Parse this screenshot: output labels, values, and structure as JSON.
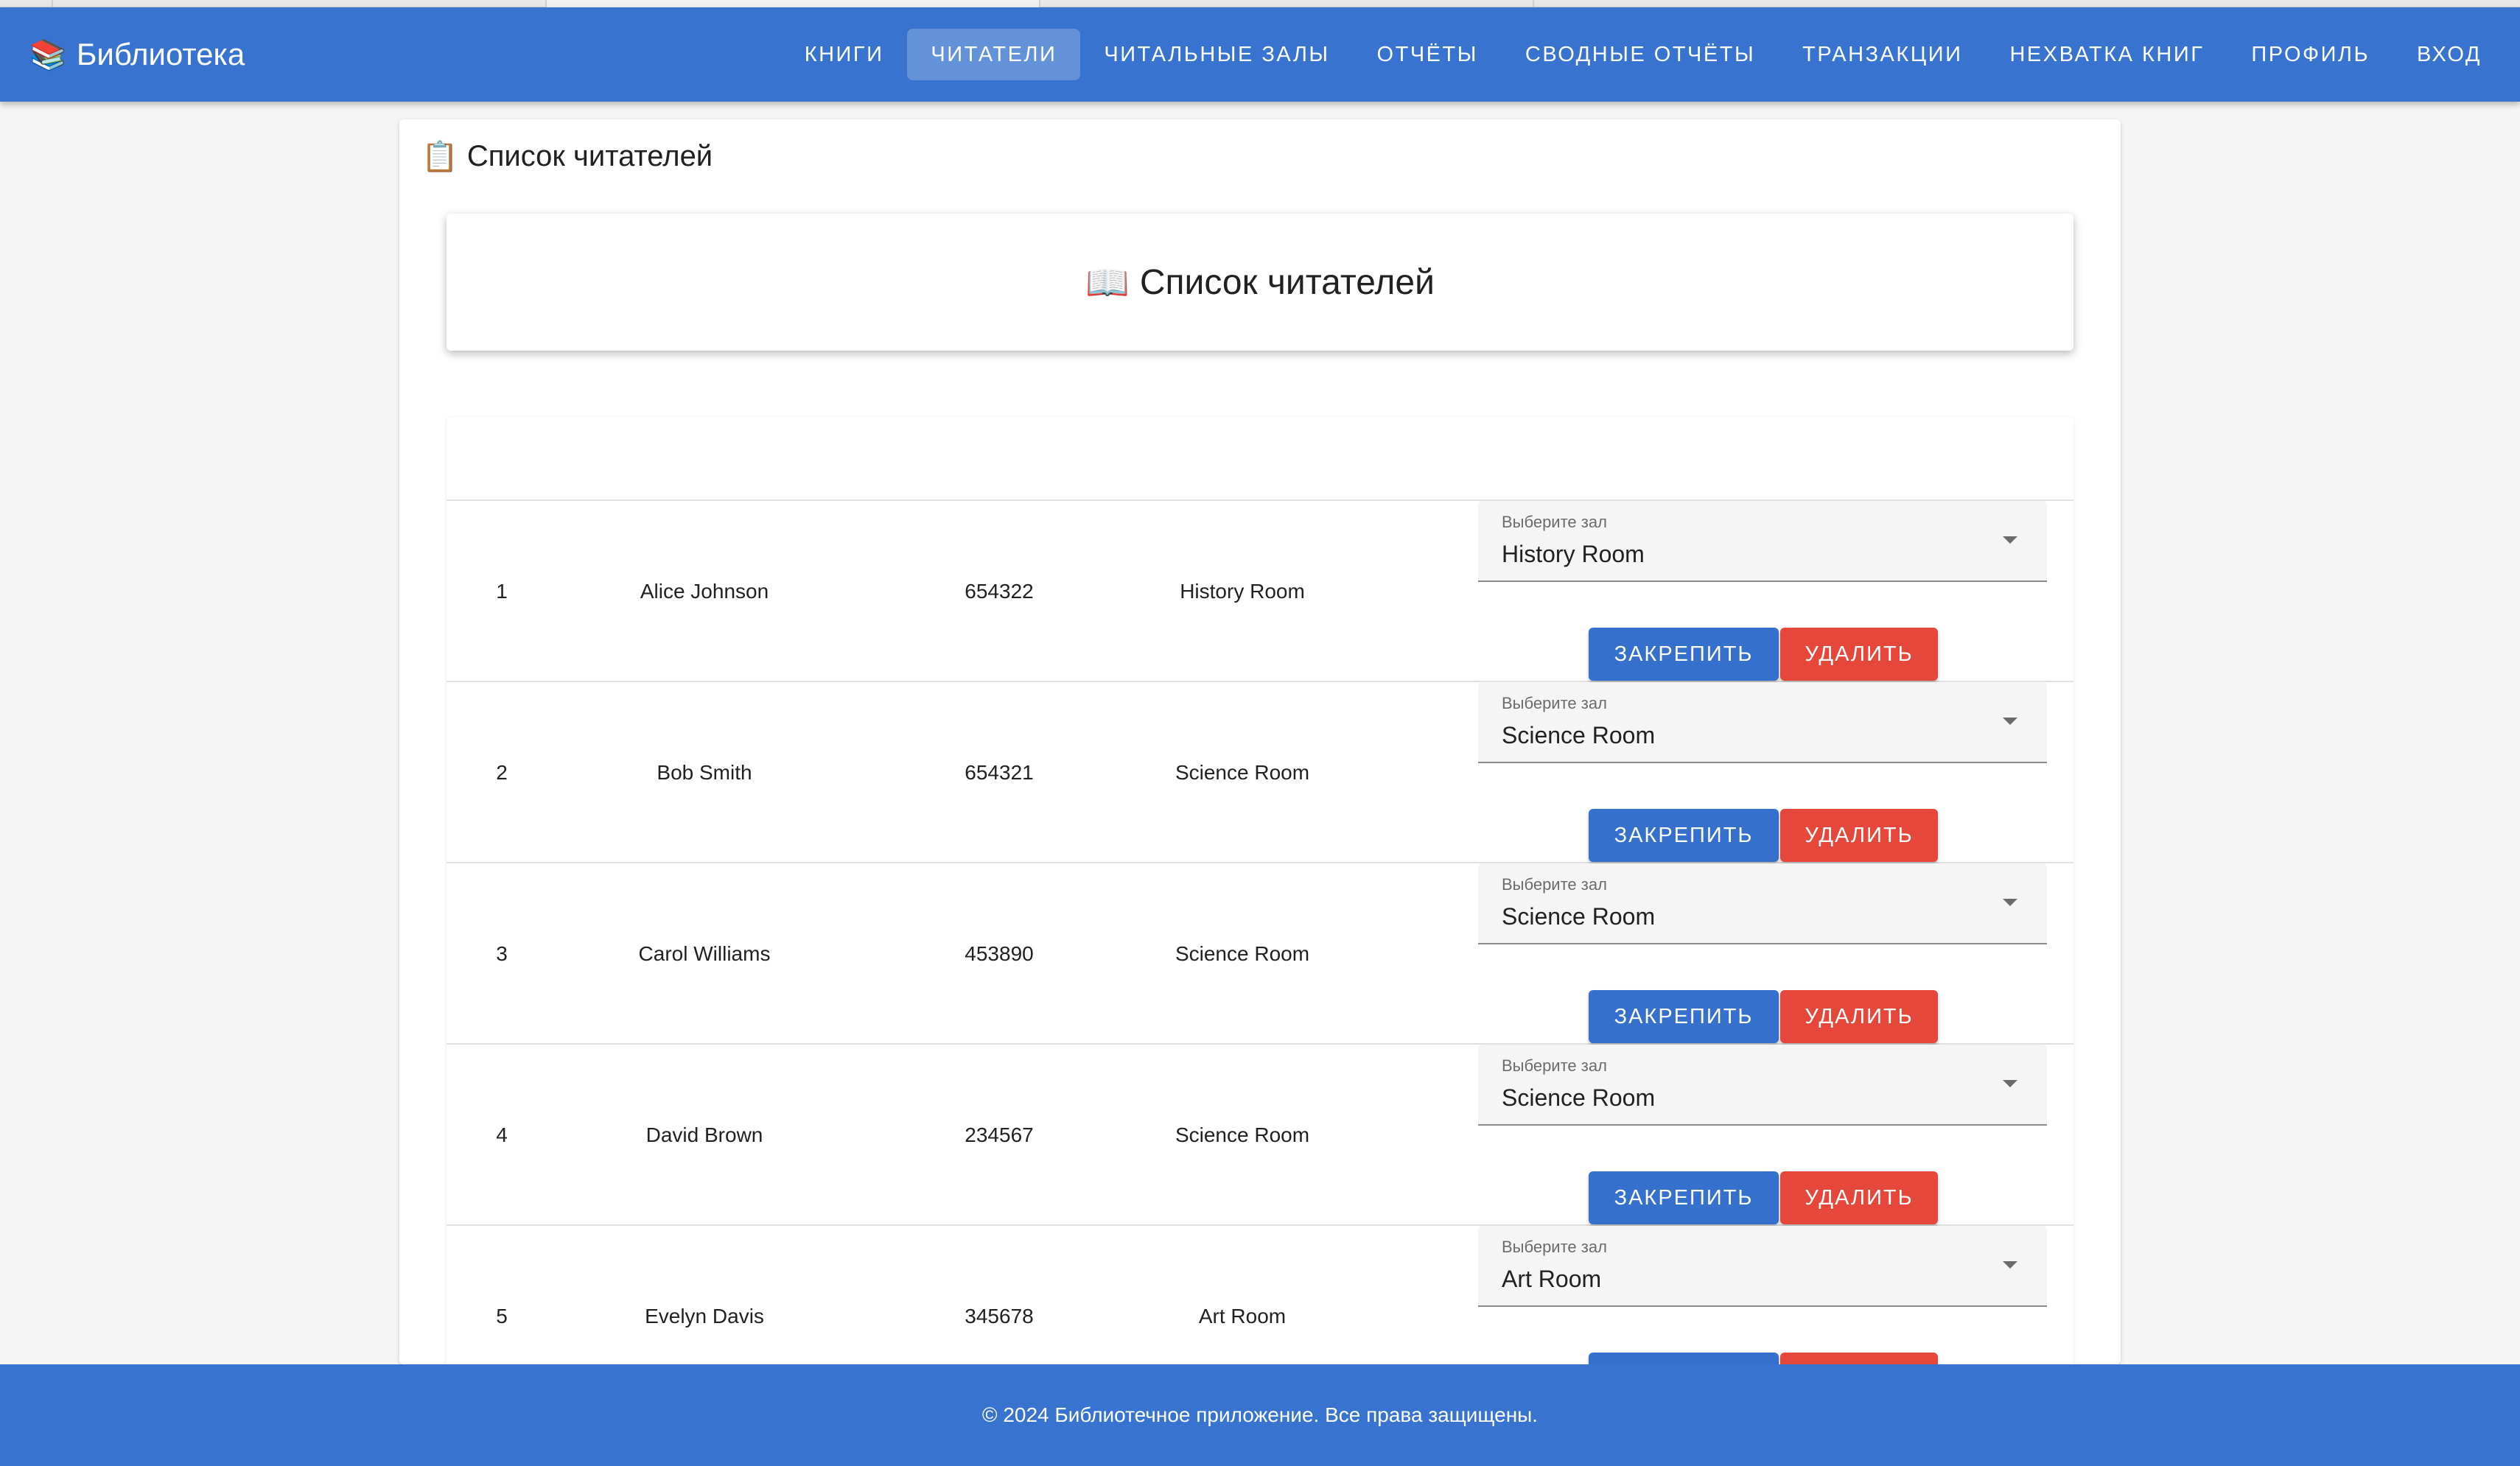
{
  "brand": {
    "icon": "📚",
    "title": "Библиотека"
  },
  "nav": [
    {
      "label": "Книги",
      "active": false
    },
    {
      "label": "Читатели",
      "active": true
    },
    {
      "label": "Читальные залы",
      "active": false
    },
    {
      "label": "Отчёты",
      "active": false
    },
    {
      "label": "Сводные отчёты",
      "active": false
    },
    {
      "label": "Транзакции",
      "active": false
    },
    {
      "label": "Нехватка книг",
      "active": false
    },
    {
      "label": "Профиль",
      "active": false
    },
    {
      "label": "Вход",
      "active": false
    }
  ],
  "page": {
    "icon": "📋",
    "title": "Список читателей"
  },
  "header_card": {
    "icon": "📖",
    "title": "Список читателей"
  },
  "select_label": "Выберите зал",
  "buttons": {
    "pin": "Закрепить",
    "delete": "Удалить"
  },
  "rows": [
    {
      "num": "1",
      "name": "Alice Johnson",
      "card": "654322",
      "room": "History Room",
      "selected": "History Room"
    },
    {
      "num": "2",
      "name": "Bob Smith",
      "card": "654321",
      "room": "Science Room",
      "selected": "Science Room"
    },
    {
      "num": "3",
      "name": "Carol Williams",
      "card": "453890",
      "room": "Science Room",
      "selected": "Science Room"
    },
    {
      "num": "4",
      "name": "David Brown",
      "card": "234567",
      "room": "Science Room",
      "selected": "Science Room"
    },
    {
      "num": "5",
      "name": "Evelyn Davis",
      "card": "345678",
      "room": "Art Room",
      "selected": "Art Room"
    }
  ],
  "footer": {
    "text": "© 2024 Библиотечное приложение. Все права защищены."
  },
  "colors": {
    "primary": "#3874cf",
    "button_pin": "#3470cc",
    "button_delete": "#e5483a"
  }
}
